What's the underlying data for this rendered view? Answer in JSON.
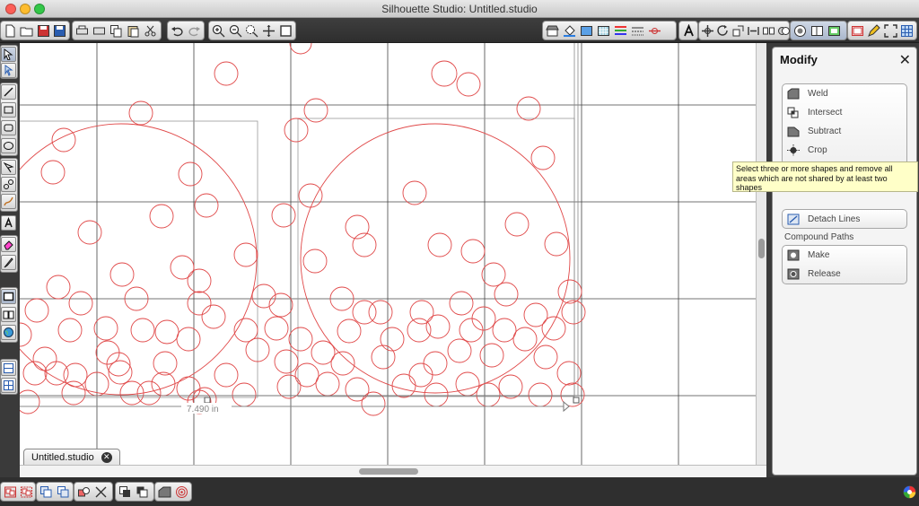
{
  "window": {
    "title": "Silhouette Studio: Untitled.studio"
  },
  "document_tab": {
    "label": "Untitled.studio",
    "close_glyph": "✕"
  },
  "ruler": {
    "dimension_label": "7.490 in"
  },
  "panel": {
    "title": "Modify",
    "close_glyph": "✕",
    "items": [
      {
        "label": "Weld",
        "icon": "weld-icon"
      },
      {
        "label": "Intersect",
        "icon": "intersect-icon"
      },
      {
        "label": "Subtract",
        "icon": "subtract-icon"
      },
      {
        "label": "Crop",
        "icon": "crop-icon"
      }
    ],
    "detach_label": "Detach Lines",
    "compound_heading": "Compound Paths",
    "compound_items": [
      {
        "label": "Make",
        "icon": "make-compound-icon"
      },
      {
        "label": "Release",
        "icon": "release-compound-icon"
      }
    ]
  },
  "tooltip": {
    "text": "Select three or more shapes and remove all areas which are not shared by at least two shapes"
  },
  "colors": {
    "shape_stroke": "#e04848",
    "grid_line": "#555555",
    "panel_bg": "#f4f4f4",
    "tooltip_bg": "#ffffc8"
  }
}
